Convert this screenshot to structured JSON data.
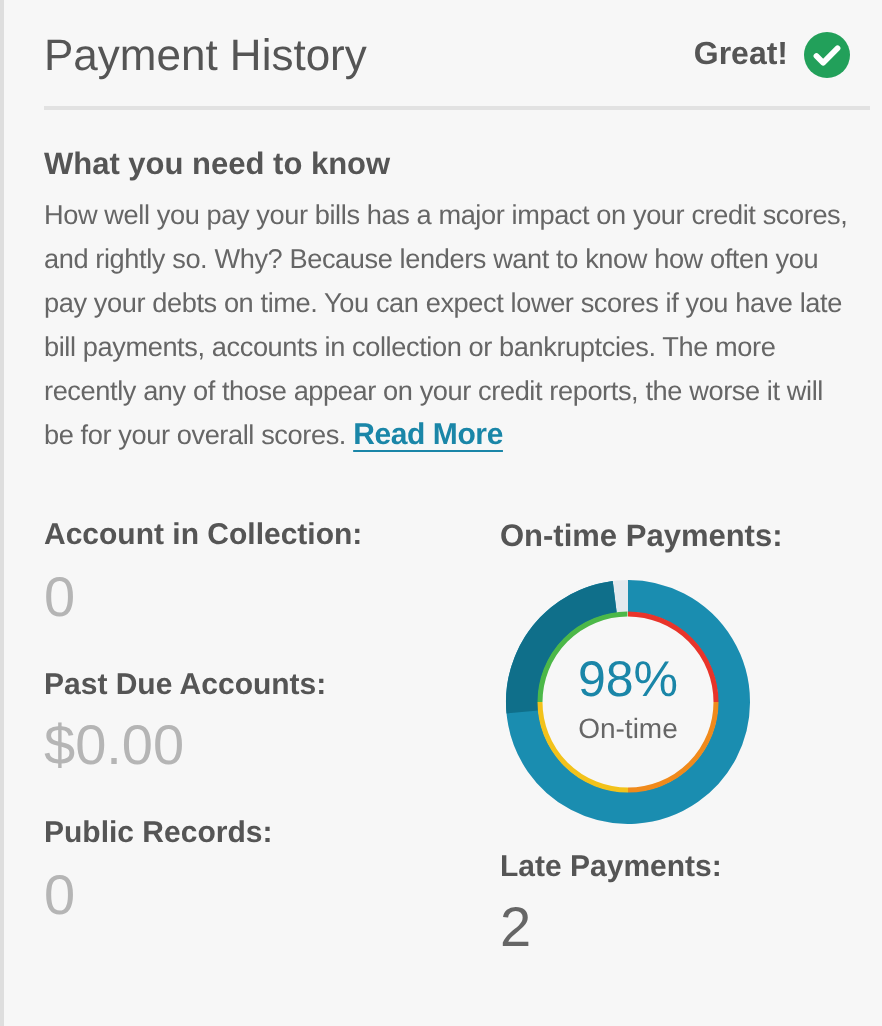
{
  "header": {
    "title": "Payment History",
    "rating": "Great!"
  },
  "info": {
    "heading": "What you need to know",
    "text": "How well you pay your bills has a major impact on your credit scores, and rightly so. Why? Because lenders want to know how often you pay your debts on time. You can expect lower scores if you have late bill payments, accounts in collection or bankruptcies. The more recently any of those appear on your credit reports, the worse it will be for your overall scores.",
    "link": "Read More"
  },
  "stats_left": [
    {
      "label": "Account in Collection:",
      "value": "0",
      "muted": true
    },
    {
      "label": "Past Due Accounts:",
      "value": "$0.00",
      "muted": true
    },
    {
      "label": "Public Records:",
      "value": "0",
      "muted": true
    }
  ],
  "ontime": {
    "label": "On-time Payments:",
    "percent": "98%",
    "caption": "On-time"
  },
  "late": {
    "label": "Late Payments:",
    "value": "2",
    "muted": false
  }
}
